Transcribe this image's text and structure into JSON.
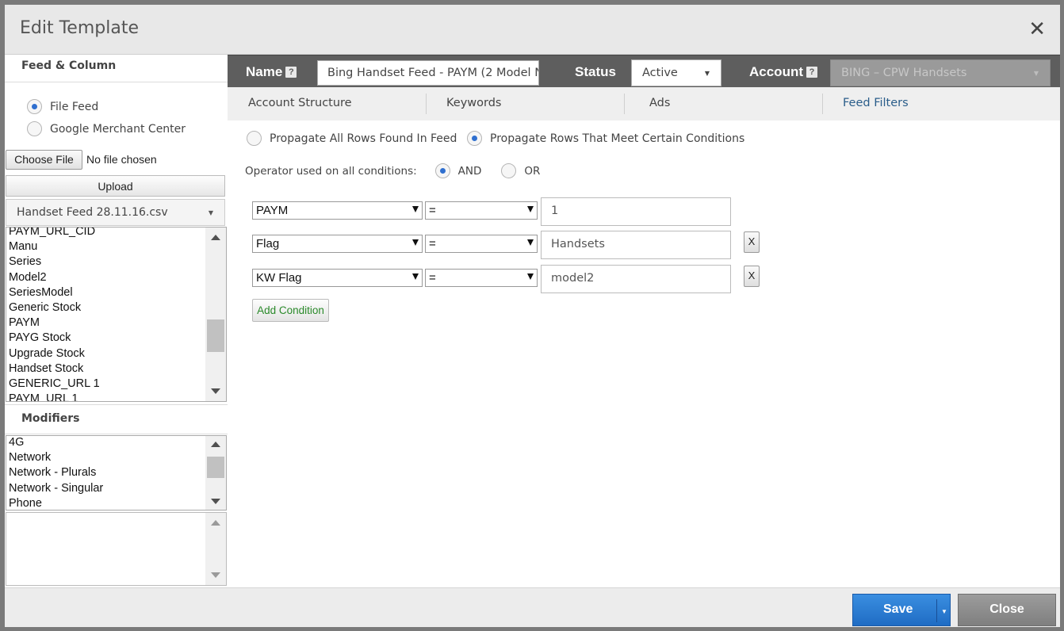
{
  "dialog": {
    "title": "Edit Template",
    "close_icon": "close-icon"
  },
  "left": {
    "feed_column_header": "Feed & Column",
    "source_options": [
      {
        "label": "File Feed",
        "selected": true
      },
      {
        "label": "Google Merchant Center",
        "selected": false
      }
    ],
    "choose_file_label": "Choose File",
    "no_file_text": "No file chosen",
    "upload_label": "Upload",
    "file_select_value": "Handset Feed 28.11.16.csv",
    "columns": [
      "PAYM_URL_CID",
      "Manu",
      "Series",
      "Model2",
      "SeriesModel",
      "Generic Stock",
      "PAYM",
      "PAYG Stock",
      "Upgrade Stock",
      "Handset Stock",
      "GENERIC_URL 1",
      "PAYM_URL 1"
    ],
    "modifiers_header": "Modifiers",
    "modifiers": [
      "4G",
      "Network",
      "Network - Plurals",
      "Network - Singular",
      "Phone"
    ]
  },
  "topbar": {
    "name_label": "Name",
    "name_value": "Bing Handset Feed - PAYM (2 Model N",
    "status_label": "Status",
    "status_value": "Active",
    "account_label": "Account",
    "account_value": "BING – CPW Handsets",
    "help_glyph": "?"
  },
  "tabs": [
    "Account Structure",
    "Keywords",
    "Ads",
    "Feed Filters"
  ],
  "active_tab": "Feed Filters",
  "filters": {
    "propagate_all_label": "Propagate All Rows Found In Feed",
    "propagate_conditions_label": "Propagate Rows That Meet Certain Conditions",
    "operator_label": "Operator used on all conditions:",
    "and_label": "AND",
    "or_label": "OR",
    "conditions": [
      {
        "column": "PAYM",
        "operator": "=",
        "value": "1",
        "removable": false
      },
      {
        "column": "Flag",
        "operator": "=",
        "value": "Handsets",
        "removable": true
      },
      {
        "column": "KW Flag",
        "operator": "=",
        "value": "model2",
        "removable": true
      }
    ],
    "remove_label": "X",
    "add_condition_label": "Add Condition"
  },
  "footer": {
    "save_label": "Save",
    "close_label": "Close"
  },
  "colors": {
    "save": "#2a7bd4",
    "topbar": "#5e5e5e",
    "active_tab": "#2a5d8a",
    "add_condition_text": "#2a8a2a"
  }
}
